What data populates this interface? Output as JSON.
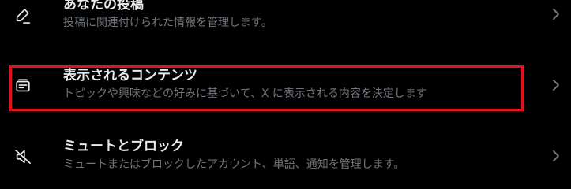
{
  "settings": {
    "items": [
      {
        "title": "あなたの投稿",
        "description": "投稿に関連付けられた情報を管理します。",
        "icon": "pencil-icon"
      },
      {
        "title": "表示されるコンテンツ",
        "description": "トピックや興味などの好みに基づいて、X に表示される内容を決定します",
        "icon": "content-feed-icon"
      },
      {
        "title": "ミュートとブロック",
        "description": "ミュートまたはブロックしたアカウント、単語、通知を管理します。",
        "icon": "mute-speaker-icon"
      }
    ]
  },
  "colors": {
    "background": "#000000",
    "title_text": "#e7e9ea",
    "description_text": "#71767b",
    "highlight_border": "#e0141b"
  }
}
